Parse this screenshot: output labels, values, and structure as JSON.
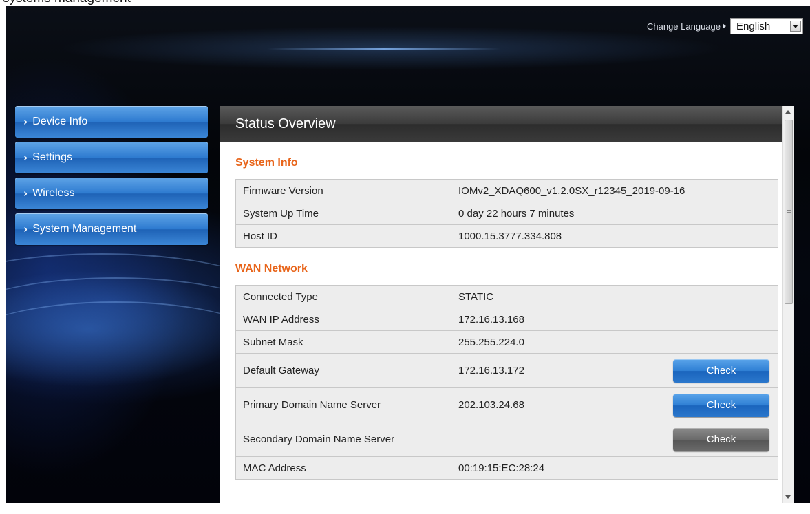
{
  "page_caption": "systems management",
  "header": {
    "change_language_label": "Change Language",
    "language_selected": "English"
  },
  "sidebar": {
    "items": [
      {
        "label": "Device Info"
      },
      {
        "label": "Settings"
      },
      {
        "label": "Wireless"
      },
      {
        "label": "System Management"
      }
    ]
  },
  "main": {
    "title": "Status Overview",
    "system_info": {
      "heading": "System Info",
      "rows": [
        {
          "key": "Firmware Version",
          "value": "IOMv2_XDAQ600_v1.2.0SX_r12345_2019-09-16"
        },
        {
          "key": "System Up Time",
          "value": "0 day 22 hours 7 minutes"
        },
        {
          "key": "Host ID",
          "value": "1000.15.3777.334.808"
        }
      ]
    },
    "wan_network": {
      "heading": "WAN Network",
      "rows": [
        {
          "key": "Connected Type",
          "value": "STATIC"
        },
        {
          "key": "WAN IP Address",
          "value": "172.16.13.168"
        },
        {
          "key": "Subnet Mask",
          "value": "255.255.224.0"
        },
        {
          "key": "Default Gateway",
          "value": "172.16.13.172",
          "button": "Check"
        },
        {
          "key": "Primary Domain Name Server",
          "value": "202.103.24.68",
          "button": "Check"
        },
        {
          "key": "Secondary Domain Name Server",
          "value": "",
          "button": "Check"
        },
        {
          "key": "MAC Address",
          "value": "00:19:15:EC:28:24"
        }
      ]
    }
  },
  "colors": {
    "section_heading": "#e8651b",
    "nav_button": "#2d7ad0",
    "check_button_active": "#2e7fd4",
    "check_button_disabled": "#6a6a6a"
  }
}
